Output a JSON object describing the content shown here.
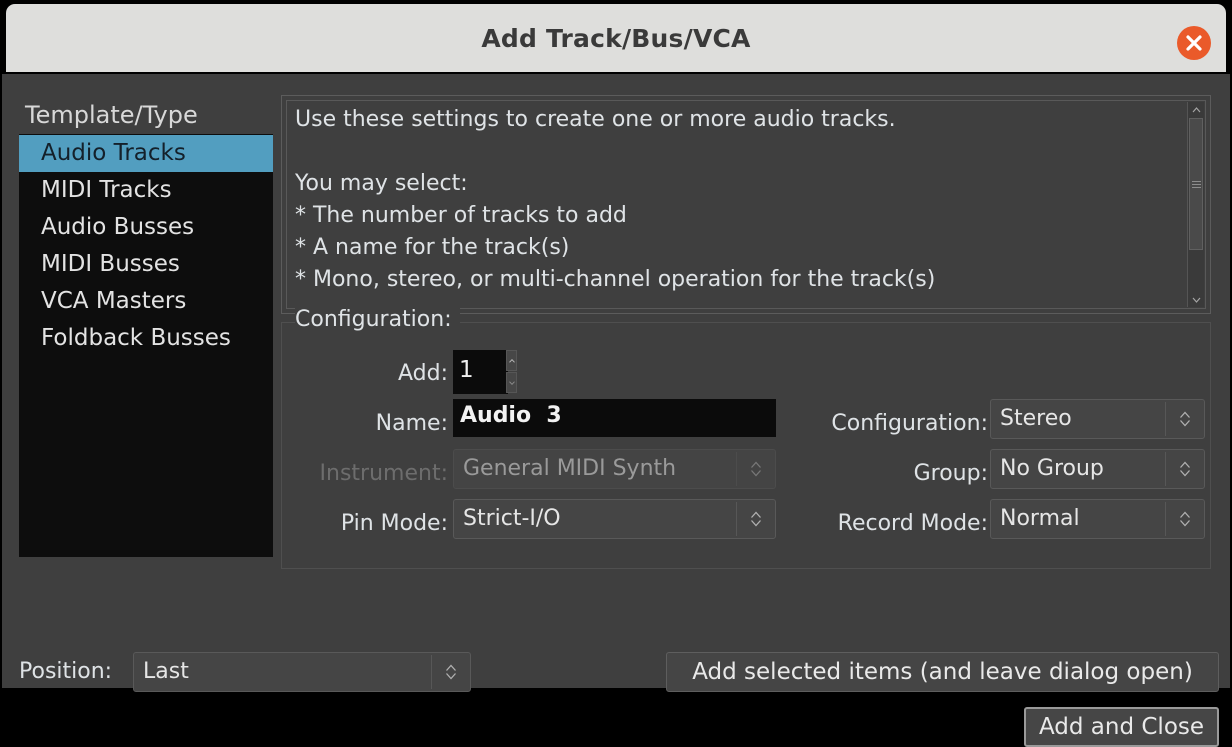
{
  "window": {
    "title": "Add Track/Bus/VCA",
    "close_icon": "close-icon"
  },
  "sidebar": {
    "header": "Template/Type",
    "items": [
      {
        "label": "Audio Tracks",
        "selected": true
      },
      {
        "label": "MIDI Tracks",
        "selected": false
      },
      {
        "label": "Audio Busses",
        "selected": false
      },
      {
        "label": "MIDI Busses",
        "selected": false
      },
      {
        "label": "VCA Masters",
        "selected": false
      },
      {
        "label": "Foldback Busses",
        "selected": false
      }
    ]
  },
  "description": {
    "text": "Use these settings to create one or more audio tracks.\n\nYou may select:\n* The number of tracks to add\n* A name for the track(s)\n* Mono, stereo, or multi-channel operation for the track(s)",
    "scrollbar": {
      "up_icon": "chevron-up-icon",
      "down_icon": "chevron-down-icon",
      "thumb": "scrollbar-thumb"
    }
  },
  "configuration": {
    "legend": "Configuration:",
    "add": {
      "label": "Add:",
      "value": "1",
      "up_icon": "spin-up-icon",
      "down_icon": "spin-down-icon"
    },
    "name": {
      "label": "Name:",
      "value": "Audio  3"
    },
    "instrument": {
      "label": "Instrument:",
      "value": "General MIDI Synth",
      "disabled": true
    },
    "pin_mode": {
      "label": "Pin Mode:",
      "value": "Strict-I/O"
    },
    "channel_configuration": {
      "label": "Configuration:",
      "value": "Stereo"
    },
    "group": {
      "label": "Group:",
      "value": "No Group"
    },
    "record_mode": {
      "label": "Record Mode:",
      "value": "Normal"
    }
  },
  "footer": {
    "position_label": "Position:",
    "position_value": "Last",
    "add_selected_label": "Add selected items (and leave dialog open)",
    "add_and_close_label": "Add and Close"
  },
  "colors": {
    "titlebar_bg": "#dededc",
    "dialog_bg": "#3f3f3f",
    "list_bg": "#0d0d0d",
    "selection": "#529ec0",
    "close_button": "#ea5a2a",
    "entry_bg": "#0b0b0b",
    "text": "#dfe3e6"
  }
}
